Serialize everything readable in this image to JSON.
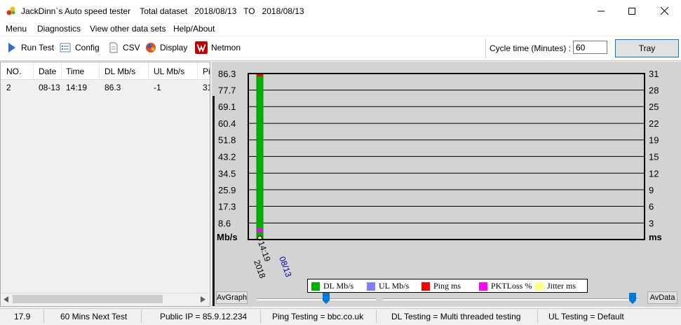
{
  "window": {
    "title": "JackDinn`s Auto speed tester    Total dataset   2018/08/13   TO   2018/08/13"
  },
  "menu": [
    "Menu",
    "Diagnostics",
    "View other data sets",
    "Help/About"
  ],
  "toolbar": {
    "run_test": "Run Test",
    "config": "Config",
    "csv": "CSV",
    "display": "Display",
    "netmon": "Netmon",
    "cycle_label": "Cycle time (Minutes) :",
    "cycle_value": "60",
    "tray": "Tray"
  },
  "table": {
    "headers": [
      "NO.",
      "Date",
      "Time",
      "DL Mb/s",
      "UL Mb/s",
      "Pi"
    ],
    "rows": [
      [
        "2",
        "08-13",
        "14:19",
        "86.3",
        "-1",
        "31"
      ]
    ]
  },
  "chart_data": {
    "type": "bar",
    "left_unit": "Mb/s",
    "right_unit": "ms",
    "left_ticks": [
      "86.3",
      "77.7",
      "69.1",
      "60.4",
      "51.8",
      "43.2",
      "34.5",
      "25.9",
      "17.3",
      "8.6"
    ],
    "right_ticks": [
      "31",
      "28",
      "25",
      "22",
      "19",
      "15",
      "12",
      "9",
      "6",
      "3"
    ],
    "ylim_left": [
      0,
      86.3
    ],
    "ylim_right": [
      0,
      31
    ],
    "x": [
      "14:19"
    ],
    "x_date": "08/13",
    "x_year": "2018",
    "series": [
      {
        "name": "DL Mb/s",
        "color": "#00b000",
        "values": [
          86.3
        ]
      },
      {
        "name": "UL Mb/s",
        "color": "#8080ff",
        "values": [
          -1
        ]
      },
      {
        "name": "Ping ms",
        "color": "#ff0000",
        "values": [
          31
        ]
      },
      {
        "name": "PKTLoss %",
        "color": "#ff00ff",
        "values": [
          0
        ]
      },
      {
        "name": "Jitter ms",
        "color": "#ffff80",
        "values": [
          0
        ]
      }
    ],
    "grid": true,
    "legend_position": "bottom"
  },
  "chart_buttons": {
    "avgraph": "AvGraph",
    "avdata": "AvData"
  },
  "status": {
    "value": "17.9",
    "next_test": "60 Mins Next Test",
    "public_ip": "Public IP = 85.9.12.234",
    "ping": "Ping Testing = bbc.co.uk",
    "dl": "DL Testing = Multi threaded testing",
    "ul": "UL Testing = Default"
  }
}
